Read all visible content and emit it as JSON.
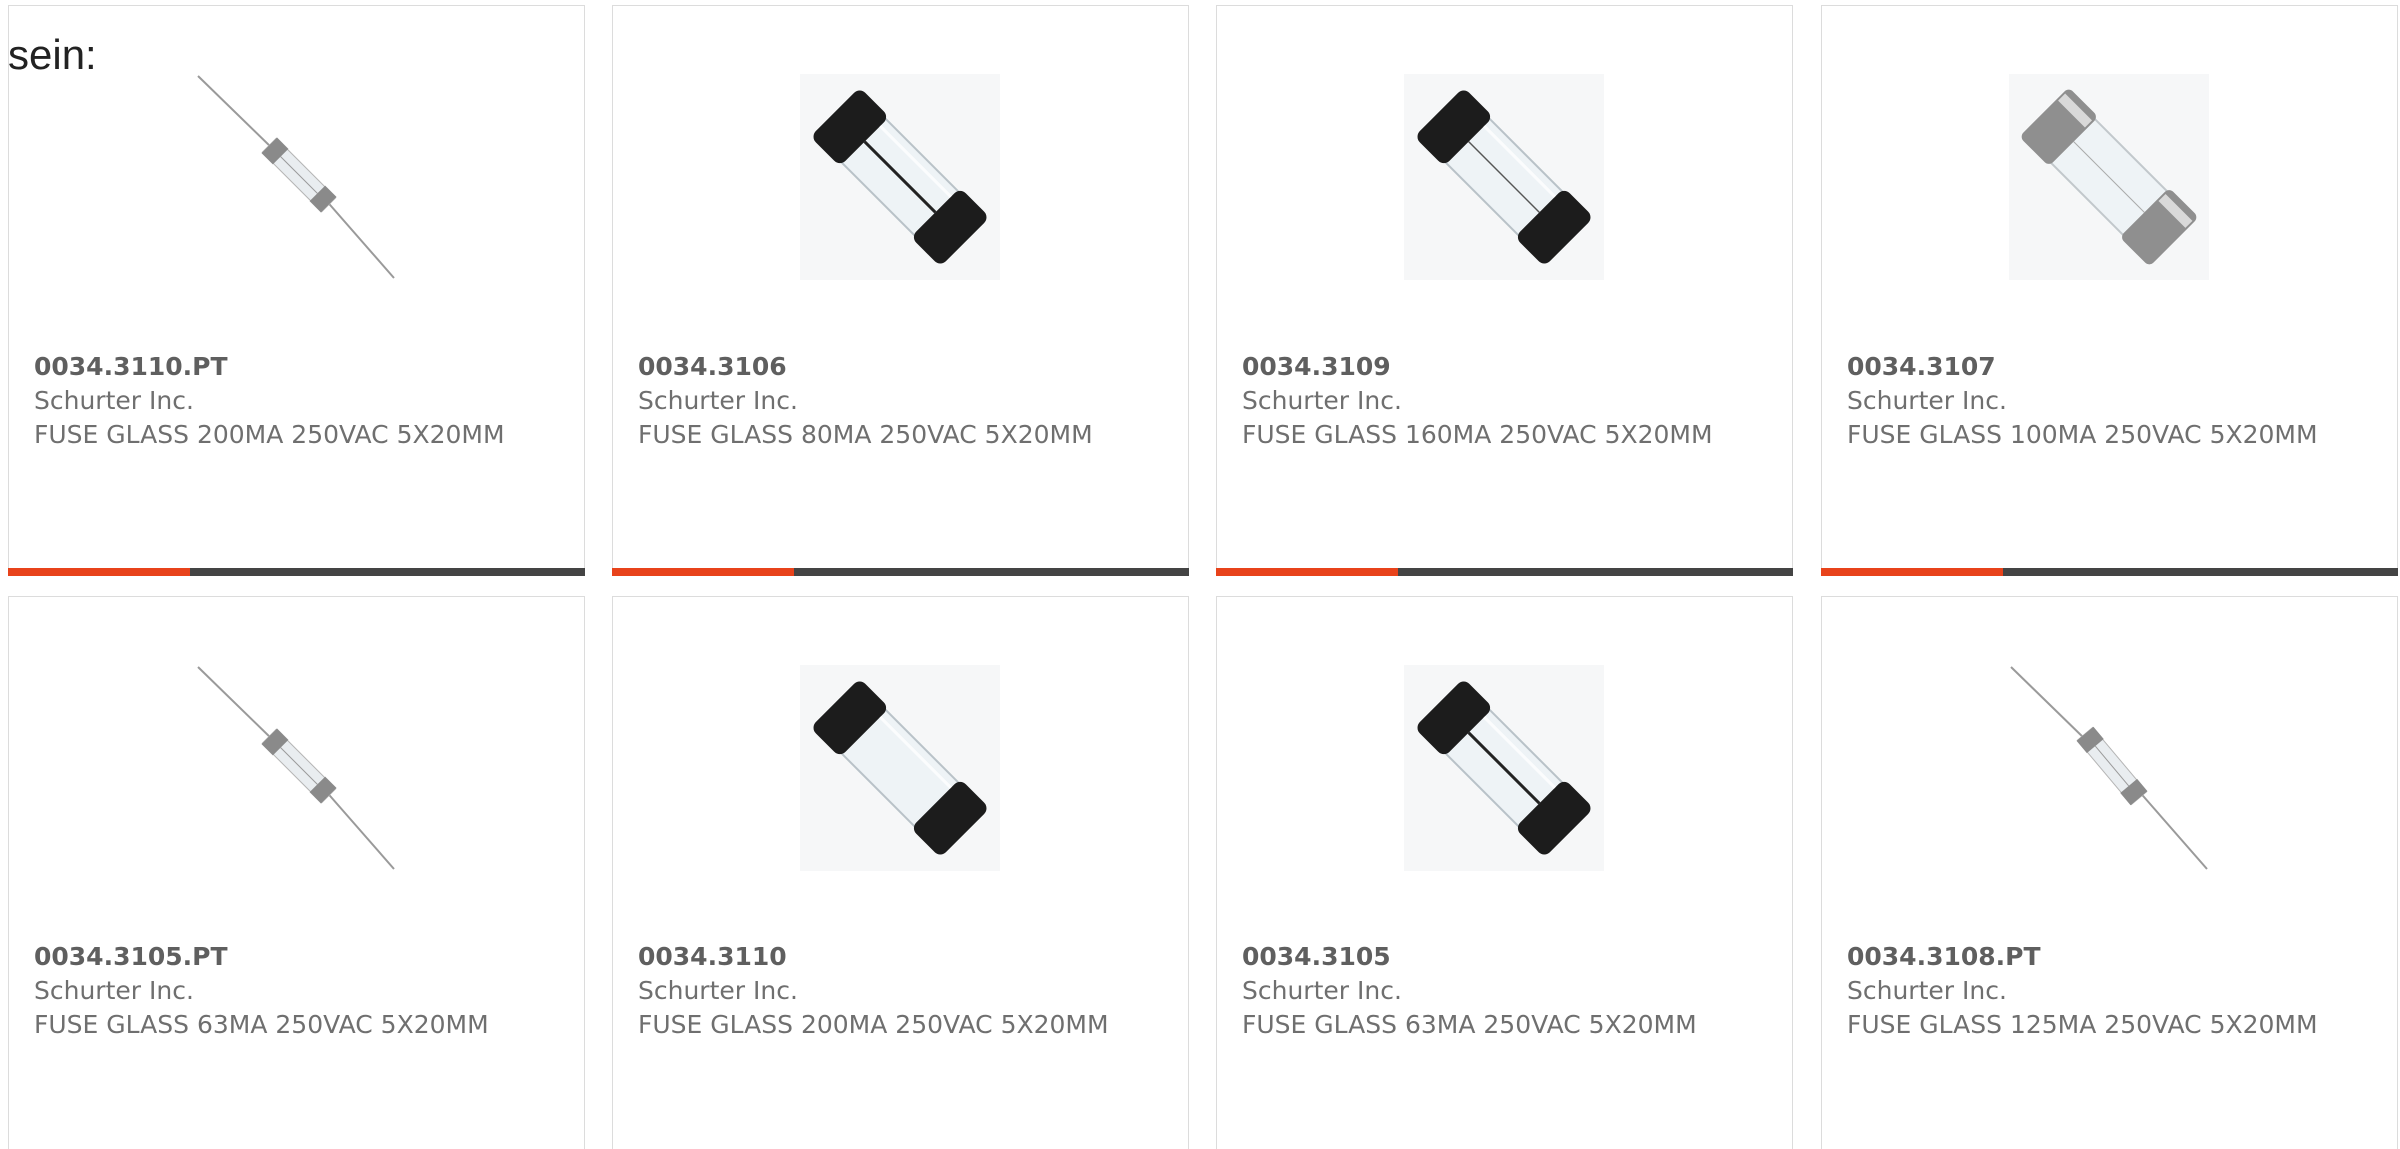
{
  "intro": "sein:",
  "colors": {
    "accent": "#e8431b",
    "bar": "#444444",
    "text": "#6f6f6f",
    "border": "#dcdcdc"
  },
  "products": [
    {
      "part_number": "0034.3110.PT",
      "manufacturer": "Schurter Inc.",
      "description": "FUSE GLASS 200MA 250VAC 5X20MM",
      "icon": "fuse-pigtail-icon"
    },
    {
      "part_number": "0034.3106",
      "manufacturer": "Schurter Inc.",
      "description": "FUSE GLASS 80MA 250VAC 5X20MM",
      "icon": "fuse-cartridge-black-icon"
    },
    {
      "part_number": "0034.3109",
      "manufacturer": "Schurter Inc.",
      "description": "FUSE GLASS 160MA 250VAC 5X20MM",
      "icon": "fuse-cartridge-black-icon"
    },
    {
      "part_number": "0034.3107",
      "manufacturer": "Schurter Inc.",
      "description": "FUSE GLASS 100MA 250VAC 5X20MM",
      "icon": "fuse-cartridge-silver-icon"
    },
    {
      "part_number": "0034.3105.PT",
      "manufacturer": "Schurter Inc.",
      "description": "FUSE GLASS 63MA 250VAC 5X20MM",
      "icon": "fuse-pigtail-icon"
    },
    {
      "part_number": "0034.3110",
      "manufacturer": "Schurter Inc.",
      "description": "FUSE GLASS 200MA 250VAC 5X20MM",
      "icon": "fuse-cartridge-black-icon"
    },
    {
      "part_number": "0034.3105",
      "manufacturer": "Schurter Inc.",
      "description": "FUSE GLASS 63MA 250VAC 5X20MM",
      "icon": "fuse-cartridge-black-icon"
    },
    {
      "part_number": "0034.3108.PT",
      "manufacturer": "Schurter Inc.",
      "description": "FUSE GLASS 125MA 250VAC 5X20MM",
      "icon": "fuse-pigtail-icon"
    }
  ]
}
